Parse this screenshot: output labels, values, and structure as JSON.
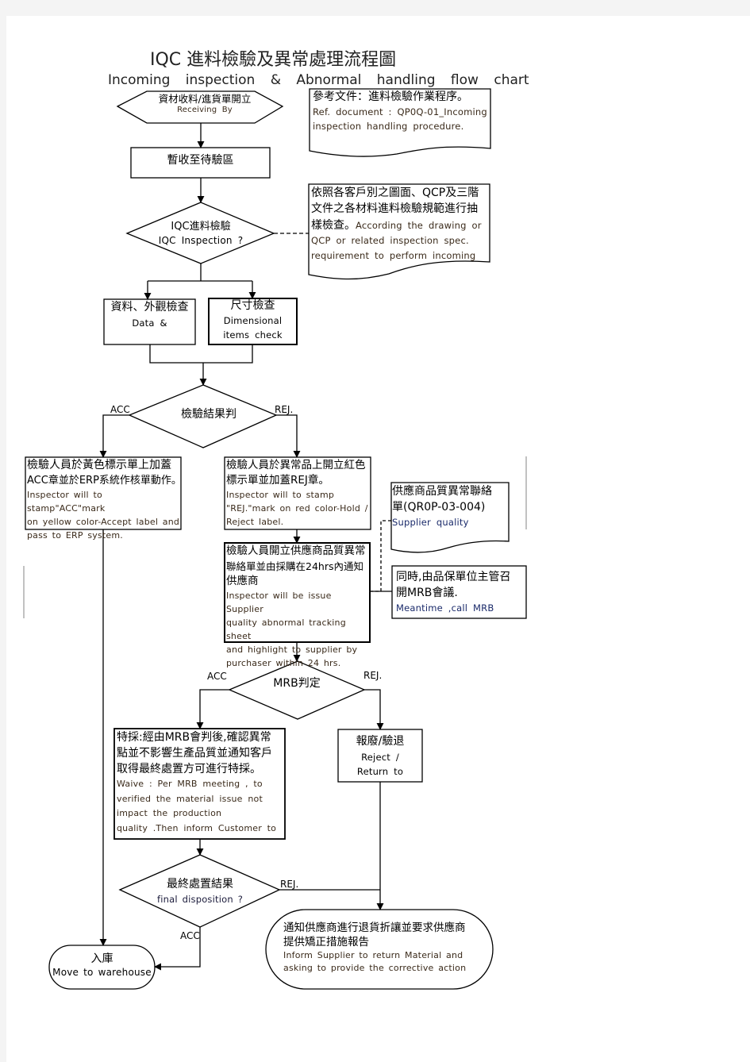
{
  "title": {
    "main": "IQC 進料檢驗及異常處理流程圖",
    "sub": "Incoming inspection & Abnormal handling flow chart"
  },
  "nodes": {
    "receiving": {
      "zh": "資材收料/進貨單開立",
      "en": "Receiving By"
    },
    "ref_doc": {
      "zh": "參考文件：進料檢驗作業程序。",
      "en1": "Ref. document : QP0Q-01_Incoming",
      "en2": "inspection handling procedure."
    },
    "temp_receive": {
      "zh": "暫收至待驗區"
    },
    "spec_doc": {
      "zh1": "依照各客戶別之圖面、QCP及三階",
      "zh2": "文件之各材料進料檢驗規範進行抽",
      "zh3": "樣檢查。",
      "en0": "According the drawing or",
      "en1": "QCP or related inspection spec.",
      "en2": "requirement to perform incoming"
    },
    "iqc_inspection": {
      "zh": "IQC進料檢驗",
      "en": "IQC Inspection ?"
    },
    "data_check": {
      "zh": "資料、外觀檢查",
      "en": "Data &"
    },
    "dim_check": {
      "zh": "尺寸檢查",
      "en1": "Dimensional",
      "en2": "items check"
    },
    "result_judge": {
      "zh": "檢驗結果判"
    },
    "acc_box": {
      "zh1": "檢驗人員於黃色標示單上加蓋",
      "zh2": "ACC章並於ERP系統作核單動作。",
      "en1": "Inspector will to stamp\"ACC\"mark",
      "en2": "on yellow color-Accept label and",
      "en3": "pass to ERP system."
    },
    "rej_box": {
      "zh1": "檢驗人員於異常品上開立紅色",
      "zh2": "標示單並加蓋REJ章。",
      "en1": "Inspector will to stamp",
      "en2": "\"REJ.\"mark on red color-Hold /",
      "en3": "Reject label."
    },
    "supplier_doc": {
      "zh1": "供應商品質異常聯絡",
      "zh2": "單(QR0P-03-004)",
      "en1": "Supplier quality"
    },
    "issue_box": {
      "zh1": "檢驗人員開立供應商品質異常",
      "zh2": "聯絡單並由採購在24hrs內通知",
      "zh3": "供應商",
      "en1": "Inspector will be issue Supplier",
      "en2": "quality abnormal tracking sheet",
      "en3": "and highlight to supplier by",
      "en4": "purchaser within 24 hrs."
    },
    "mrb_meeting": {
      "zh1": "同時,由品保單位主管召",
      "zh2": "開MRB會議.",
      "en1": "Meantime ,call MRB"
    },
    "mrb_judge": {
      "zh": "MRB判定"
    },
    "waive_box": {
      "zh1": "特採:經由MRB會判後,確認異常",
      "zh2": "點並不影響生產品質並通知客戶",
      "zh3": "取得最終處置方可進行特採。",
      "en1": "Waive : Per MRB meeting , to",
      "en2": "verified the material issue not",
      "en3": "impact the production",
      "en4": "quality .Then inform Customer to"
    },
    "reject_box": {
      "zh": "報廢/驗退",
      "en1": "Reject /",
      "en2": "Return to"
    },
    "final_disp": {
      "zh": "最終處置結果",
      "en": "final disposition ?"
    },
    "warehouse": {
      "zh": "入庫",
      "en": "Move to warehouse"
    },
    "inform_supplier": {
      "zh1": "通知供應商進行退貨折讓並要求供應商",
      "zh2": "提供矯正措施報告",
      "en1": "Inform Supplier to return Material and",
      "en2": "asking to provide the corrective action"
    }
  },
  "edge_labels": {
    "acc": "ACC",
    "rej": "REJ."
  }
}
